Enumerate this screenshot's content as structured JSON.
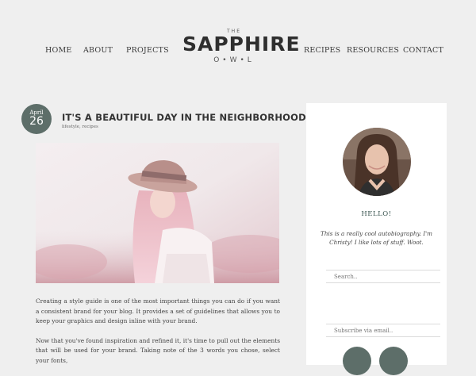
{
  "nav": {
    "left": [
      {
        "label": "HOME"
      },
      {
        "label": "ABOUT"
      },
      {
        "label": "PROJECTS"
      }
    ],
    "right": [
      {
        "label": "RECIPES"
      },
      {
        "label": "RESOURCES"
      },
      {
        "label": "CONTACT"
      }
    ]
  },
  "logo": {
    "the": "THE",
    "name": "SAPPHIRE",
    "sub": "O•W•L"
  },
  "post": {
    "month": "April",
    "day": "26",
    "title": "IT'S A BEAUTIFUL DAY IN THE NEIGHBORHOOD",
    "tags": "lifestyle, recipes",
    "paragraphs": [
      "Creating a style guide is one of the most important things you can do if you want a consistent brand for your blog. It provides a set of guidelines that allows you to keep your graphics and design inline with your brand.",
      "Now that you've found inspiration and refined it, it's time to pull out the elements that will be used for your brand. Taking note of the 3 words you chose, select your fonts,"
    ]
  },
  "sidebar": {
    "hello": "HELLO!",
    "bio": "This is a really cool autobiography. I'm Christy! I like lots of stuff. Woot.",
    "search_placeholder": "Search..",
    "subscribe_placeholder": "Subscribe via email.."
  },
  "colors": {
    "accent": "#5d6e69",
    "background": "#efefef",
    "sidebar_bg": "#ffffff"
  }
}
